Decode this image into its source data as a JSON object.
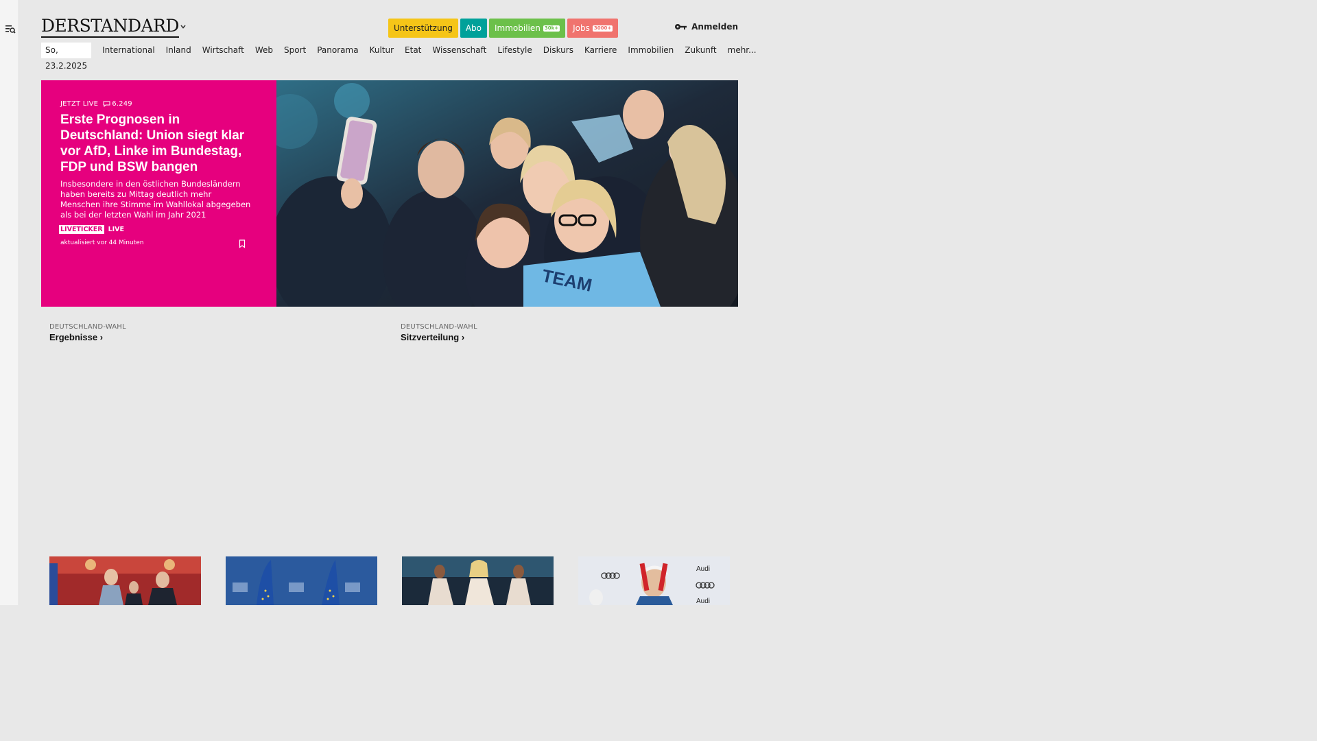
{
  "header": {
    "logo_text": "DERSTANDARD",
    "buttons": [
      {
        "label": "Unterstützung",
        "color": "#f5c518",
        "text_color": "#222"
      },
      {
        "label": "Abo",
        "color": "#00a19a",
        "text_color": "#fff"
      },
      {
        "label": "Immobilien",
        "badge": "30k+",
        "color": "#6cc04a",
        "text_color": "#fff"
      },
      {
        "label": "Jobs",
        "badge": "3000+",
        "color": "#f0736e",
        "text_color": "#fff"
      }
    ],
    "login_label": "Anmelden"
  },
  "nav": {
    "date": "So, 23.2.2025",
    "items": [
      "International",
      "Inland",
      "Wirtschaft",
      "Web",
      "Sport",
      "Panorama",
      "Kultur",
      "Etat",
      "Wissenschaft",
      "Lifestyle",
      "Diskurs",
      "Karriere",
      "Immobilien",
      "Zukunft",
      "mehr..."
    ]
  },
  "hero": {
    "kicker": "JETZT LIVE",
    "comments": "6.249",
    "headline": "Erste Prognosen in Deutschland: Union siegt klar vor AfD, Linke im Bundestag, FDP und BSW bangen",
    "lead": "Insbesondere in den östlichen Bundesländern haben bereits zu Mittag deutlich mehr Menschen ihre Stimme im Wahllokal abgegeben als bei der letzten Wahl im Jahr 2021",
    "tag1": "LIVETICKER",
    "tag2": "LIVE",
    "updated": "aktualisiert vor 44 Minuten",
    "accent": "#e6007e",
    "image_sign_text": "TEAM"
  },
  "sublinks": [
    {
      "kicker": "DEUTSCHLAND-WAHL",
      "title": "Ergebnisse ›"
    },
    {
      "kicker": "DEUTSCHLAND-WAHL",
      "title": "Sitzverteilung ›"
    }
  ],
  "thumb_texts": {
    "audi": "Audi"
  }
}
